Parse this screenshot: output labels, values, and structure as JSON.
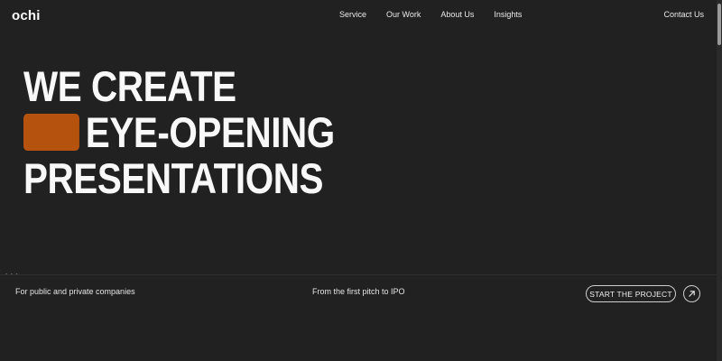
{
  "header": {
    "logo": "ochi",
    "nav": [
      {
        "label": "Service"
      },
      {
        "label": "Our Work"
      },
      {
        "label": "About Us"
      },
      {
        "label": "Insights"
      }
    ],
    "contact_label": "Contact Us"
  },
  "hero": {
    "line1": "WE CREATE",
    "line2": "EYE-OPENING",
    "line3": "PRESENTATIONS"
  },
  "footer_bar": {
    "left_text": "For public and private companies",
    "mid_text": "From the first pitch to IPO",
    "cta_label": "START THE PROJECT"
  },
  "icons": {
    "cta_arrow": "arrow-up-right-icon"
  },
  "colors": {
    "background": "#212121",
    "accent": "#b5520e",
    "text": "#f5f5f5"
  }
}
